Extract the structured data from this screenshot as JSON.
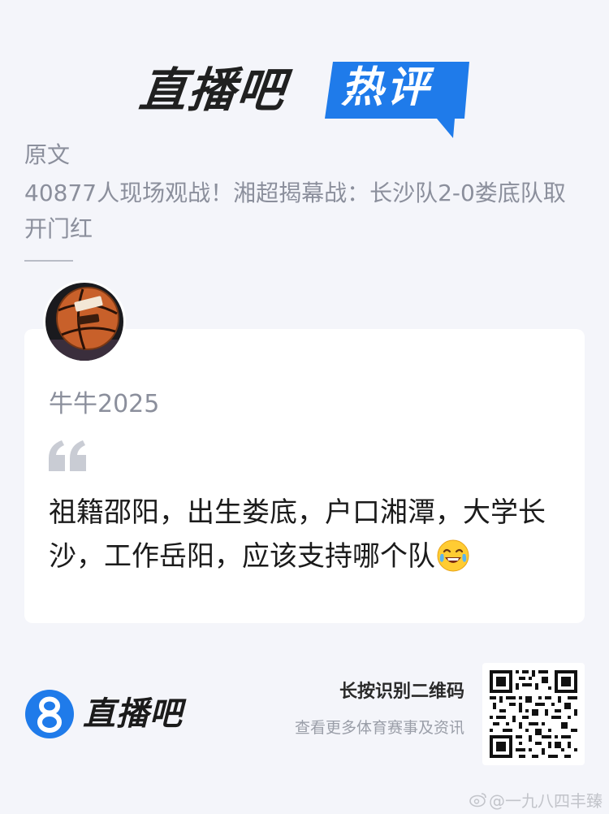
{
  "header": {
    "brand_name": "直播吧",
    "badge_text": "热评",
    "badge_color": "#1f7bea"
  },
  "article": {
    "label": "原文",
    "title": "40877人现场观战！湘超揭幕战：长沙队2-0娄底队取开门红"
  },
  "comment": {
    "avatar_icon": "basketball-avatar",
    "username": "牛牛2025",
    "quote_icon": "quote-mark-icon",
    "text": "祖籍邵阳，出生娄底，户口湘潭，大学长沙，工作岳阳，应该支持哪个队",
    "emoji": "laughing-with-tears-emoji"
  },
  "footer": {
    "logo_glyph": "8",
    "logo_text": "直播吧",
    "qr_label": "长按识别二维码",
    "qr_sublabel": "查看更多体育赛事及资讯",
    "qr_icon": "qr-code"
  },
  "watermark": {
    "icon": "weibo-icon",
    "text": "@一九八四丰臻"
  },
  "colors": {
    "background": "#f4f5fa",
    "card": "#ffffff",
    "muted_text": "#8b8f9c",
    "accent_blue": "#1f7bea"
  }
}
